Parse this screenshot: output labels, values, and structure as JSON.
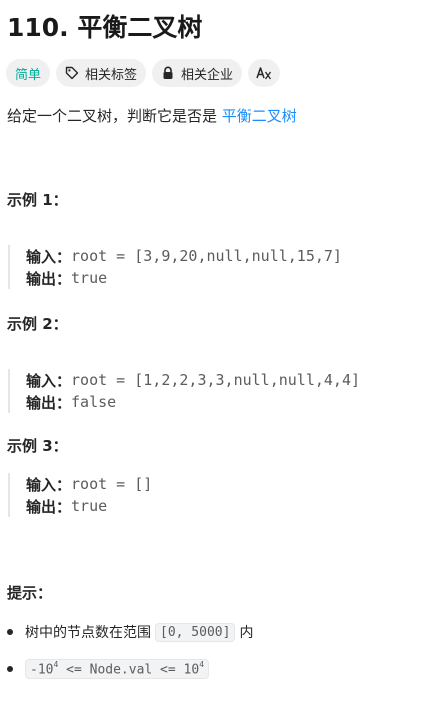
{
  "problem": {
    "title": "110. 平衡二叉树",
    "tags": {
      "difficulty": "简单",
      "topics": "相关标签",
      "companies": "相关企业"
    },
    "description_prefix": "给定一个二叉树，判断它是否是 ",
    "description_link": "平衡二叉树"
  },
  "examples": [
    {
      "heading": "示例 1：",
      "input_label": "输入：",
      "input": "root = [3,9,20,null,null,15,7]",
      "output_label": "输出：",
      "output": "true"
    },
    {
      "heading": "示例 2：",
      "input_label": "输入：",
      "input": "root = [1,2,2,3,3,null,null,4,4]",
      "output_label": "输出：",
      "output": "false"
    },
    {
      "heading": "示例 3：",
      "input_label": "输入：",
      "input": "root = []",
      "output_label": "输出：",
      "output": "true"
    }
  ],
  "constraints": {
    "heading": "提示：",
    "items": [
      {
        "text_before": "树中的节点数在范围 ",
        "code": "[0, 5000]",
        "text_after": " 内"
      },
      {
        "code_a": "-10",
        "sup_a": "4",
        "code_b": " <= Node.val <= 10",
        "sup_b": "4"
      }
    ]
  },
  "colors": {
    "easy": "#00af9b",
    "link": "#1a8cff",
    "tag_bg": "#f0f0f0",
    "code_bg": "#f2f3f5"
  },
  "icons": [
    "tag-icon",
    "lock-icon",
    "translate-icon"
  ]
}
